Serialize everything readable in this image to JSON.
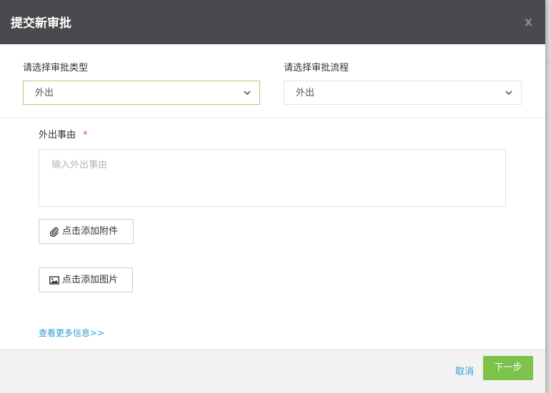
{
  "dialog": {
    "title": "提交新审批",
    "close_label": "x"
  },
  "type_select": {
    "label": "请选择审批类型",
    "value": "外出"
  },
  "flow_select": {
    "label": "请选择审批流程",
    "value": "外出"
  },
  "reason": {
    "label": "外出事由",
    "required_mark": "*",
    "placeholder": "输入外出事由"
  },
  "attachment_button": {
    "label": "点击添加附件",
    "icon": "paperclip-icon"
  },
  "image_button": {
    "label": "点击添加图片",
    "icon": "image-icon"
  },
  "more_link": "查看更多信息>>",
  "footer": {
    "cancel_label": "取消",
    "next_label": "下一步"
  },
  "colors": {
    "header_bg": "#484a4d",
    "active_border": "#a6d17c",
    "link": "#2d9fd8",
    "primary_button": "#7dc24a",
    "required": "#e5484d"
  }
}
